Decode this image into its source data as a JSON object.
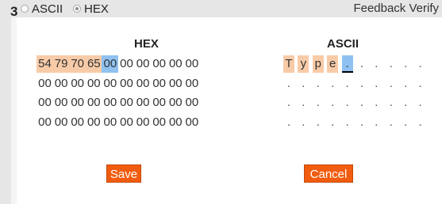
{
  "header": {
    "step_number": "3",
    "mode_options": [
      {
        "label": "ASCII",
        "selected": false
      },
      {
        "label": "HEX",
        "selected": true
      }
    ],
    "feedback_label": "Feedback Verify"
  },
  "editor": {
    "hex_title": "HEX",
    "ascii_title": "ASCII",
    "hex_rows": [
      [
        "54",
        "79",
        "70",
        "65",
        "00",
        "00",
        "00",
        "00",
        "00",
        "00"
      ],
      [
        "00",
        "00",
        "00",
        "00",
        "00",
        "00",
        "00",
        "00",
        "00",
        "00"
      ],
      [
        "00",
        "00",
        "00",
        "00",
        "00",
        "00",
        "00",
        "00",
        "00",
        "00"
      ],
      [
        "00",
        "00",
        "00",
        "00",
        "00",
        "00",
        "00",
        "00",
        "00",
        "00"
      ]
    ],
    "ascii_rows": [
      [
        "T",
        "y",
        "p",
        "e",
        ".",
        ".",
        ".",
        ".",
        ".",
        "."
      ],
      [
        ".",
        ".",
        ".",
        ".",
        ".",
        ".",
        ".",
        ".",
        ".",
        "."
      ],
      [
        ".",
        ".",
        ".",
        ".",
        ".",
        ".",
        ".",
        ".",
        ".",
        "."
      ],
      [
        ".",
        ".",
        ".",
        ".",
        ".",
        ".",
        ".",
        ".",
        ".",
        "."
      ]
    ],
    "filled_count": 4,
    "cursor_index": 4
  },
  "buttons": {
    "save_label": "Save",
    "cancel_label": "Cancel"
  },
  "colors": {
    "filled": "#f8cba8",
    "cursor": "#8fc2f1",
    "button": "#f25c0f"
  }
}
